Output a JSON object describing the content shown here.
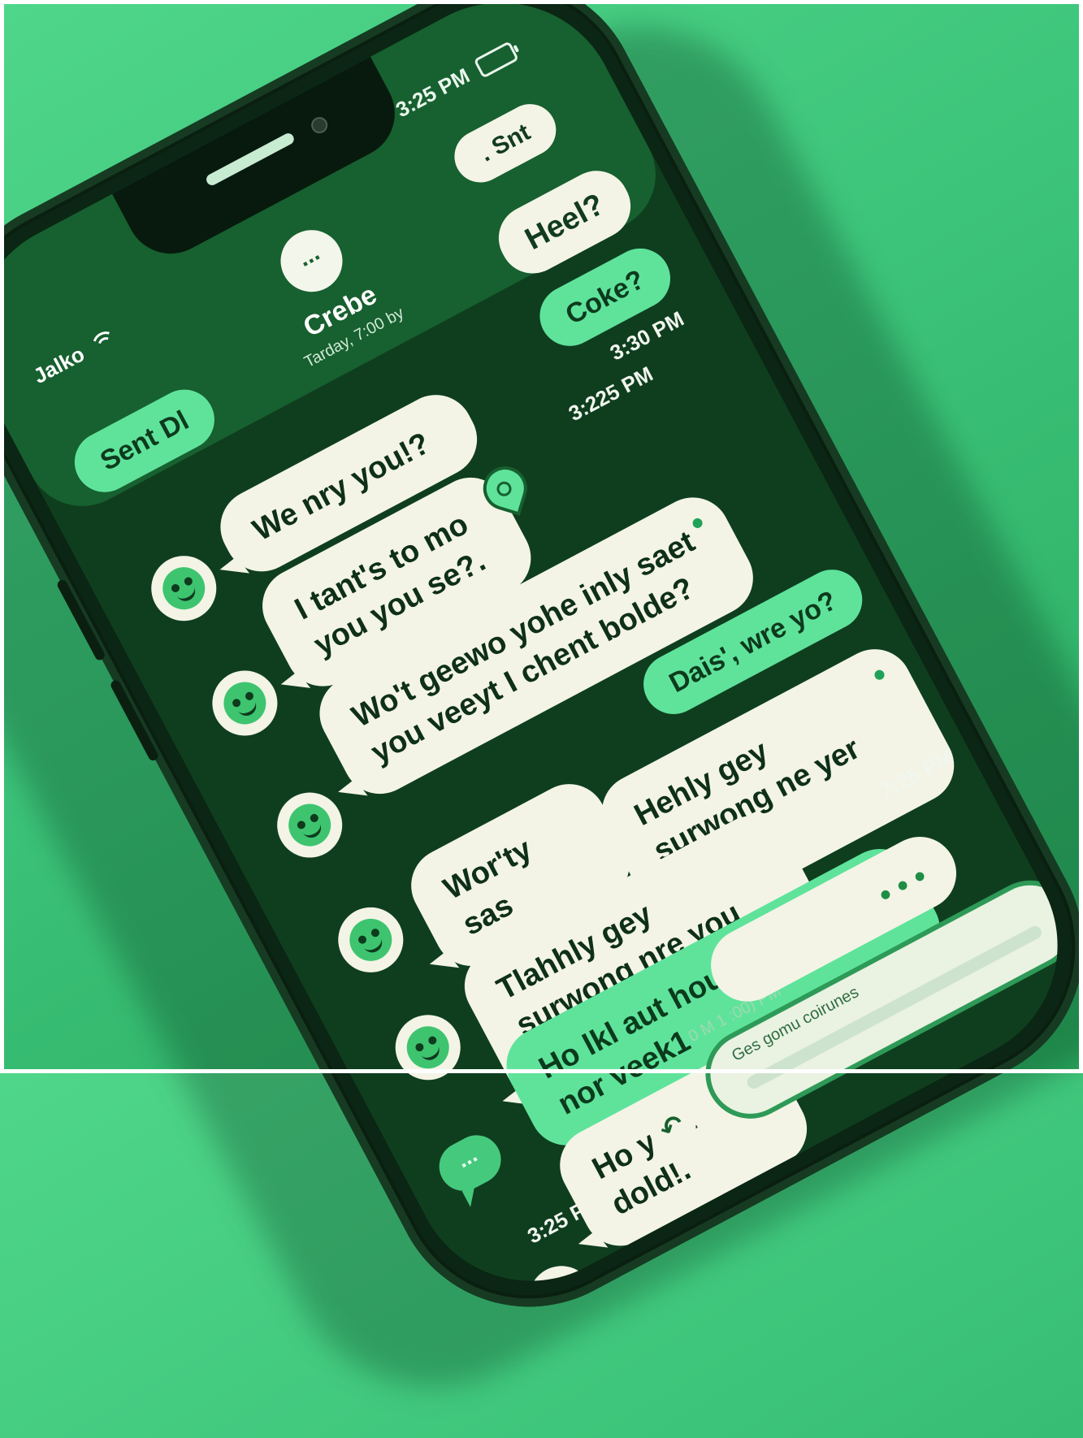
{
  "status_bar": {
    "carrier": "Jalko",
    "time": "3:25 PM",
    "sent_label": ". Snt"
  },
  "contact": {
    "avatar_text": "...",
    "name": "Crebe",
    "subtitle": "Tarday, 7:00 by"
  },
  "quick_replies": {
    "sent": "Sent Dl",
    "heel": "Heel?",
    "coke": "Coke?"
  },
  "messages": [
    {
      "text": "We nry you!?"
    },
    {
      "text": "I tant's to mo you you se?."
    },
    {
      "text": "Wo't geewo yohe inly saet you veeyt I chent bolde?"
    },
    {
      "text": "Dais', wre yo?"
    },
    {
      "text": "Wor'ty sas"
    },
    {
      "text": "Hehly gey surwong ne yer you"
    },
    {
      "text": "Tlahhly gey surwong nre you you me?"
    },
    {
      "text": "Ho lkl aut hous, yo lers nor veek1"
    },
    {
      "text": "Ho yeat dold!."
    }
  ],
  "timestamps": {
    "t1": "3:30 PM",
    "t2": "3:225 PM",
    "t3": "7:25 PM",
    "t4": "3:25 PM",
    "t5": "0 M 1 :00) PM"
  },
  "composer": {
    "placeholder": "Ges gomu coirunes"
  },
  "icons": {
    "heart": "heart-icon",
    "attach": "attach-icon"
  },
  "colors": {
    "background": "#3cc47a",
    "screen": "#0f3e1f",
    "bubble": "#f3f4e6",
    "accent": "#5fe39b"
  }
}
